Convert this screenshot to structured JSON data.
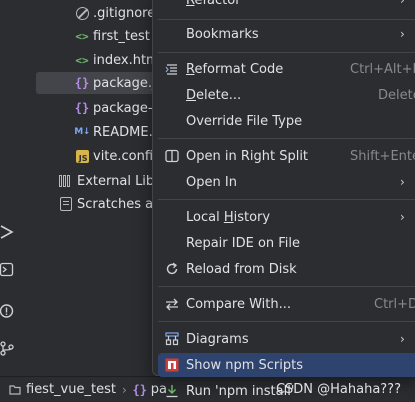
{
  "tree": {
    "items": [
      {
        "label": ".gitignore",
        "icon": "gitignore-icon"
      },
      {
        "label": "first_test",
        "icon": "html-file-icon"
      },
      {
        "label": "index.html",
        "icon": "html-file-icon"
      },
      {
        "label": "package.json",
        "icon": "json-file-icon",
        "selected": true
      },
      {
        "label": "package-lock.json",
        "icon": "json-file-icon"
      },
      {
        "label": "README.md",
        "icon": "markdown-file-icon"
      },
      {
        "label": "vite.config.js",
        "icon": "js-file-icon"
      },
      {
        "label": "External Libraries",
        "icon": "library-icon"
      },
      {
        "label": "Scratches and Consoles",
        "icon": "scratches-icon"
      }
    ]
  },
  "menu": {
    "items": [
      {
        "label_pre": "",
        "label_u": "R",
        "label_post": "efactor",
        "shortcut": "",
        "submenu": true
      },
      {
        "label_pre": "Bookmarks",
        "label_u": "",
        "label_post": "",
        "shortcut": "",
        "submenu": true
      },
      {
        "label_pre": "",
        "label_u": "R",
        "label_post": "eformat Code",
        "shortcut": "Ctrl+Alt+L",
        "submenu": false,
        "icon": "reformat-icon"
      },
      {
        "label_pre": "",
        "label_u": "D",
        "label_post": "elete...",
        "shortcut": "Delete",
        "submenu": false
      },
      {
        "label_pre": "Override File Type",
        "label_u": "",
        "label_post": "",
        "shortcut": "",
        "submenu": false
      },
      {
        "label_pre": "Open in Right Split",
        "label_u": "",
        "label_post": "",
        "shortcut": "Shift+Enter",
        "submenu": false,
        "icon": "split-icon"
      },
      {
        "label_pre": "Open In",
        "label_u": "",
        "label_post": "",
        "shortcut": "",
        "submenu": true
      },
      {
        "label_pre": "Local ",
        "label_u": "H",
        "label_post": "istory",
        "shortcut": "",
        "submenu": true
      },
      {
        "label_pre": "Repair IDE on File",
        "label_u": "",
        "label_post": "",
        "shortcut": "",
        "submenu": false
      },
      {
        "label_pre": "Reload from Disk",
        "label_u": "",
        "label_post": "",
        "shortcut": "",
        "submenu": false,
        "icon": "reload-icon"
      },
      {
        "label_pre": "Compare With...",
        "label_u": "",
        "label_post": "",
        "shortcut": "Ctrl+D",
        "submenu": false,
        "icon": "compare-icon"
      },
      {
        "label_pre": "Diagrams",
        "label_u": "",
        "label_post": "",
        "shortcut": "",
        "submenu": true,
        "icon": "diagram-icon"
      },
      {
        "label_pre": "Show npm Scripts",
        "label_u": "",
        "label_post": "",
        "shortcut": "",
        "submenu": false,
        "icon": "npm-icon",
        "highlighted": true
      },
      {
        "label_pre": "Run 'npm install'",
        "label_u": "",
        "label_post": "",
        "shortcut": "",
        "submenu": false,
        "icon": "npm-install-icon"
      }
    ]
  },
  "breadcrumb": {
    "project": "fiest_vue_test",
    "file": "pa"
  },
  "watermark": "CSDN @Hahaha???",
  "colors": {
    "background": "#2b2d30",
    "highlight": "#2e436e",
    "selection": "#43454a",
    "npm_red": "#c9413b"
  }
}
